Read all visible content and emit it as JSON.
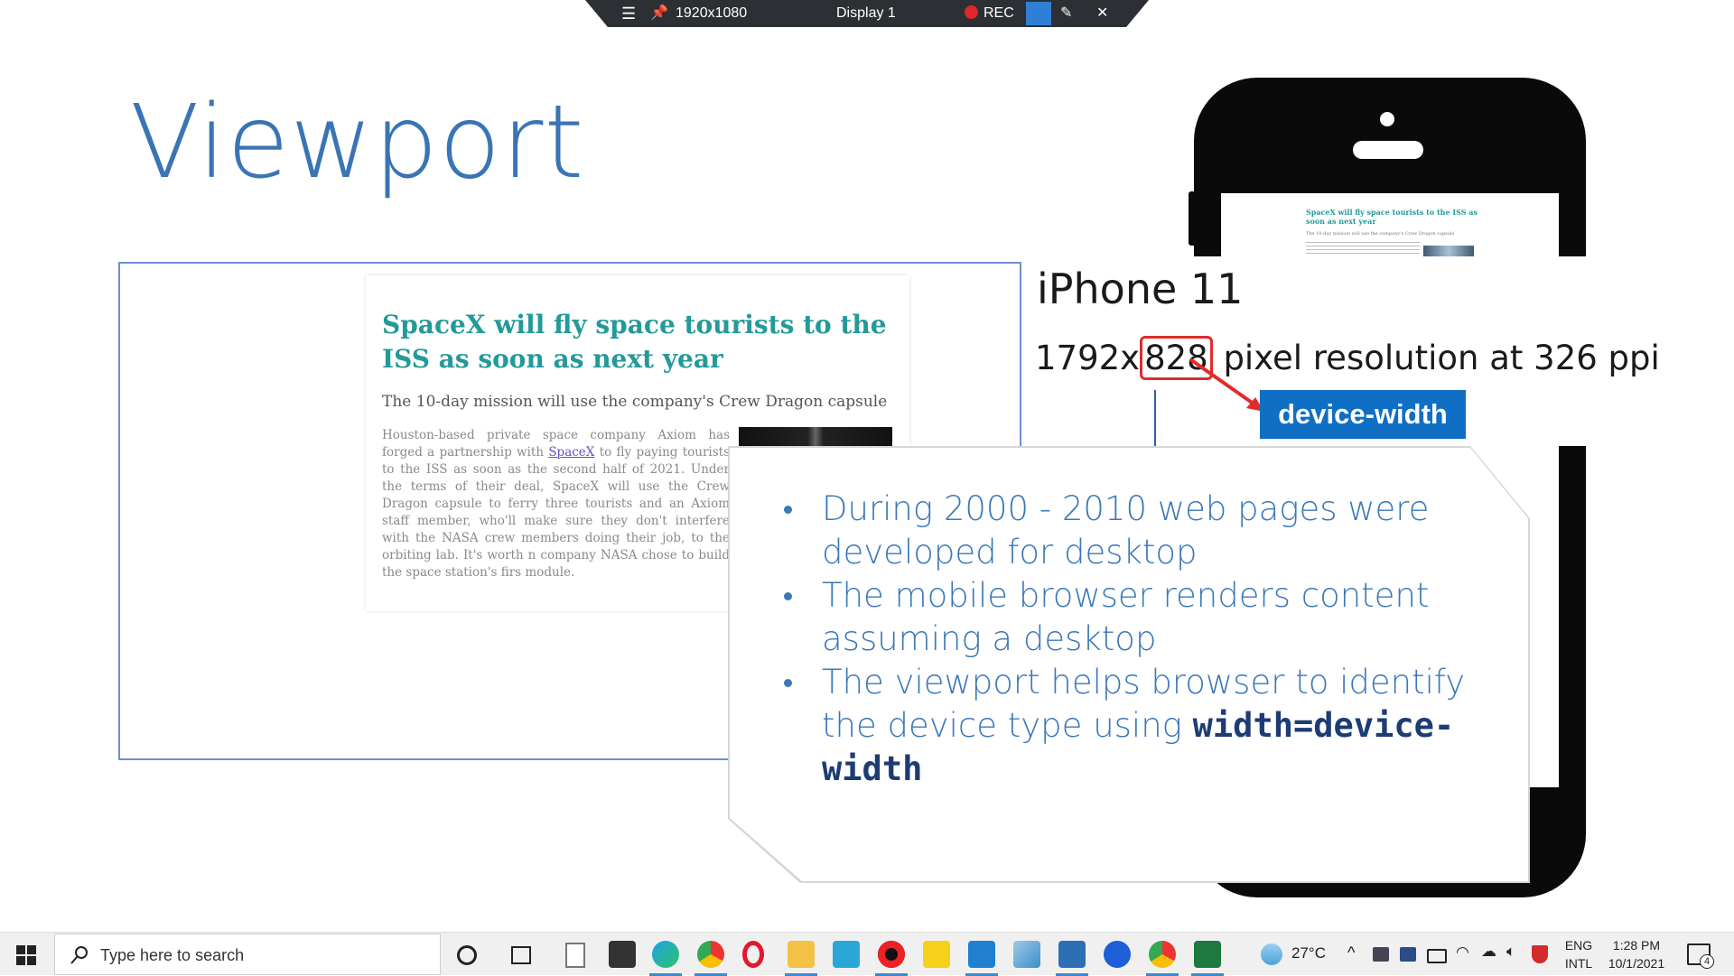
{
  "recorder": {
    "resolution": "1920x1080",
    "display": "Display 1",
    "rec_label": "REC"
  },
  "slide": {
    "title": "Viewport",
    "article": {
      "headline": "SpaceX will fly space tourists to the ISS as soon as next year",
      "subhead": "The 10-day mission will use the company's Crew Dragon capsule",
      "body_start": "Houston-based private space company Axiom has forged a partnership with ",
      "body_link": "SpaceX",
      "body_end": " to fly paying tourists to the ISS as soon as the second half of 2021. Under the terms of their deal, SpaceX will use the Crew Dragon capsule to ferry three tourists and an Axiom staff member, who'll make sure they don't interfere with the NASA crew members doing their job, to the orbiting lab. It's worth n company NASA chose to build the space station's firs module."
    },
    "device": {
      "name": "iPhone 11",
      "res_prefix": "1792x",
      "res_highlight": "828",
      "res_suffix": " pixel resolution at 326 ppi",
      "badge": "device-width"
    },
    "bullets": {
      "b1": "During 2000 - 2010 web pages were developed for desktop",
      "b2": "The mobile browser renders content assuming a desktop",
      "b3_text": "The viewport helps browser to identify the device type using ",
      "b3_code": "width=device-width"
    }
  },
  "taskbar": {
    "search_placeholder": "Type here to search",
    "weather": "27°C",
    "lang1": "ENG",
    "lang2": "INTL",
    "time": "1:28 PM",
    "date": "10/1/2021",
    "notifications": "4"
  },
  "colors": {
    "title_blue": "#3a74b5",
    "teal": "#239a99",
    "badge_blue": "#0e6fc4",
    "highlight_red": "#e22b2b"
  }
}
